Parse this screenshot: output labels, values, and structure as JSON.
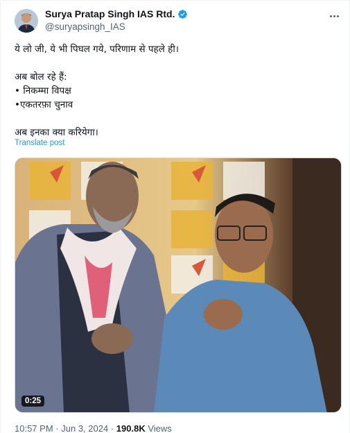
{
  "post": {
    "author_name": "Surya Pratap Singh IAS Rtd.",
    "author_handle": "@suryapsingh_IAS",
    "text_lines": [
      "ये लो जी, ये भी पिघल गये, परिणाम से पहले ही।",
      "अब बोल रहे हैं:",
      "• निकम्मा विपक्ष",
      "•एकतरफ़ा चुनाव",
      "अब इनका क्या करियेगा।"
    ],
    "translate_label": "Translate post",
    "video_duration": "0:25",
    "time": "10:57 PM",
    "separator": "·",
    "date": "Jun 3, 2024",
    "views_count": "190.8K",
    "views_label": "Views"
  },
  "icons": {
    "verified": "verified-badge-icon",
    "more": "more-options-icon"
  },
  "colors": {
    "accent": "#1d9bf0",
    "secondary_text": "#536471",
    "primary_text": "#0f1419"
  }
}
